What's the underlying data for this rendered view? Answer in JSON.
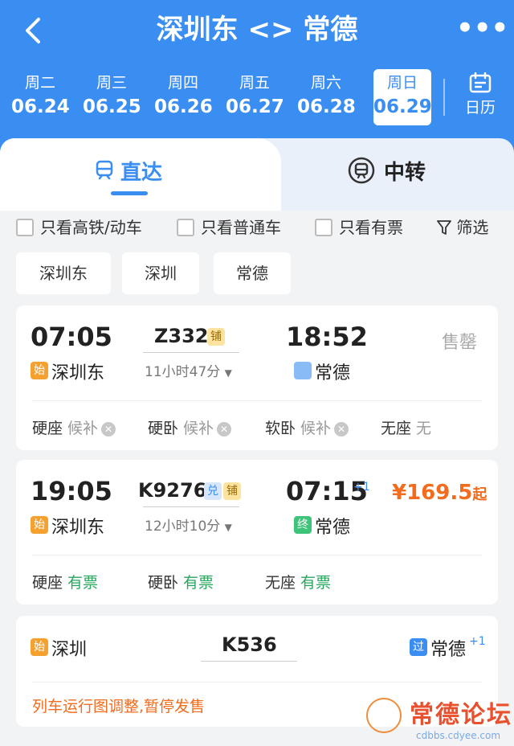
{
  "header": {
    "title": "深圳东 <> 常德",
    "more_label": "•••",
    "dates": [
      {
        "weekday": "周二",
        "date": "06.24"
      },
      {
        "weekday": "周三",
        "date": "06.25"
      },
      {
        "weekday": "周四",
        "date": "06.26"
      },
      {
        "weekday": "周五",
        "date": "06.27"
      },
      {
        "weekday": "周六",
        "date": "06.28"
      },
      {
        "weekday": "周日",
        "date": "06.29"
      }
    ],
    "calendar_label": "日历"
  },
  "tabs": {
    "direct": "直达",
    "transfer": "中转"
  },
  "filters": {
    "high_speed": "只看高铁/动车",
    "regular": "只看普通车",
    "available": "只看有票",
    "screen": "筛选"
  },
  "station_chips": [
    "深圳东",
    "深圳",
    "常德"
  ],
  "trains": [
    {
      "dep_time": "07:05",
      "dep_station": "深圳东",
      "dep_tag": "始",
      "train_no": "Z332",
      "badge_sleeper": "铺",
      "duration": "11小时47分",
      "arr_time": "18:52",
      "arr_station": "常德",
      "status": "售罄",
      "seats": [
        {
          "name": "硬座",
          "status": "候补"
        },
        {
          "name": "硬卧",
          "status": "候补"
        },
        {
          "name": "软卧",
          "status": "候补"
        },
        {
          "name": "无座",
          "status": "无"
        }
      ]
    },
    {
      "dep_time": "19:05",
      "dep_station": "深圳东",
      "dep_tag": "始",
      "train_no": "K9276",
      "badge_exchange": "兑",
      "badge_sleeper": "铺",
      "duration": "12小时10分",
      "arr_time": "07:15",
      "arr_day_offset": "+1",
      "arr_station": "常德",
      "arr_tag": "终",
      "price": "¥169.5",
      "price_suffix": "起",
      "seats": [
        {
          "name": "硬座",
          "status": "有票"
        },
        {
          "name": "硬卧",
          "status": "有票"
        },
        {
          "name": "无座",
          "status": "有票"
        }
      ]
    },
    {
      "dep_station": "深圳",
      "dep_tag": "始",
      "train_no": "K536",
      "arr_station": "常德",
      "arr_tag": "过",
      "arr_day_offset": "+1",
      "notice": "列车运行图调整,暂停发售"
    }
  ],
  "watermark": {
    "title": "常德论坛",
    "url": "cdbbs.cdyee.com"
  },
  "colors": {
    "primary": "#3a8ef2",
    "orange": "#f36b1c",
    "green": "#28a55e"
  }
}
